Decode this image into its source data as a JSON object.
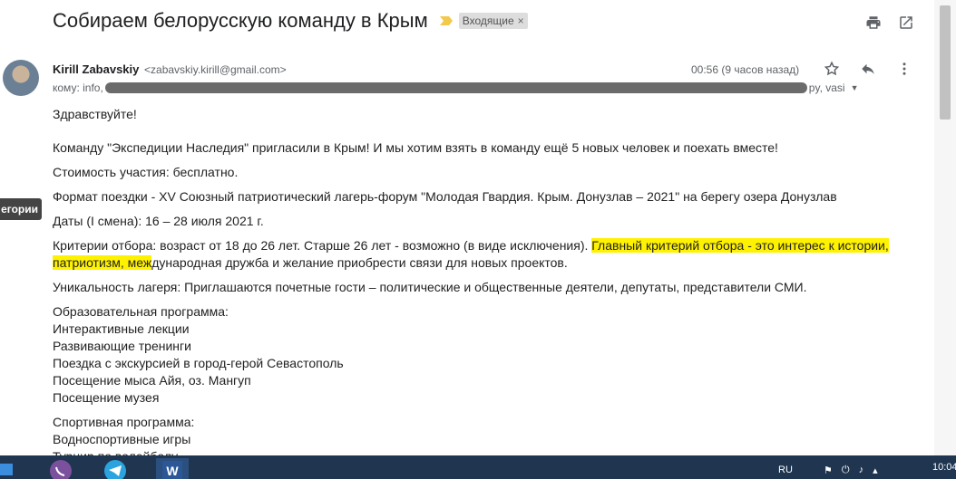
{
  "subject": "Собираем белорусскую команду в Крым",
  "label": {
    "text": "Входящие",
    "remove": "×"
  },
  "icons": {
    "print": "print-icon",
    "open": "open-in-new-window-icon",
    "star": "star-icon",
    "reply": "reply-icon",
    "more": "more-vert-icon"
  },
  "sender": {
    "name": "Kirill Zabavskiy",
    "email": "<zabavskiy.kirill@gmail.com>"
  },
  "recipients": {
    "prefix": "кому: info,",
    "suffix": "py, vasi"
  },
  "time": "00:56 (9 часов назад)",
  "sidebar_tab": "егории",
  "body": {
    "greeting": "Здравствуйте!",
    "p1": "Команду \"Экспедиции Наследия\" пригласили в Крым! И мы хотим взять в команду ещё 5 новых человек и поехать вместе!",
    "p2": "Стоимость участия: бесплатно.",
    "p3": "Формат поездки - XV Союзный патриотический лагерь-форум \"Молодая Гвардия. Крым. Донузлав – 2021\" на берегу озера Донузлав",
    "p4": "Даты (I смена): 16 – 28 июля 2021 г.",
    "p5_plain": "Критерии отбора: возраст от 18 до 26 лет. Старше 26 лет - возможно (в виде исключения). ",
    "p5_highlight": "Главный критерий отбора - это интерес к истории, патриотизм, меж",
    "p5_rest": "дународная дружба и желание приобрести связи для новых проектов.",
    "p6": "Уникальность лагеря: Приглашаются почетные гости – политические и общественные деятели, депутаты, представители СМИ.",
    "edu_title": "Образовательная программа:",
    "edu_items": [
      "Интерактивные лекции",
      "Развивающие тренинги",
      "Поездка с экскурсией в город-герой Севастополь",
      "Посещение мыса Айя, оз. Мангуп",
      "Посещение музея"
    ],
    "sport_title": "Спортивная программа:",
    "sport_items": [
      "Водноспортивные игры",
      "Турнир по волейболу"
    ]
  },
  "taskbar": {
    "lang": "RU",
    "clock": "10:04"
  },
  "colors": {
    "highlight": "#fff200",
    "taskbar": "#1f3550",
    "label_bg": "#dddddd"
  }
}
